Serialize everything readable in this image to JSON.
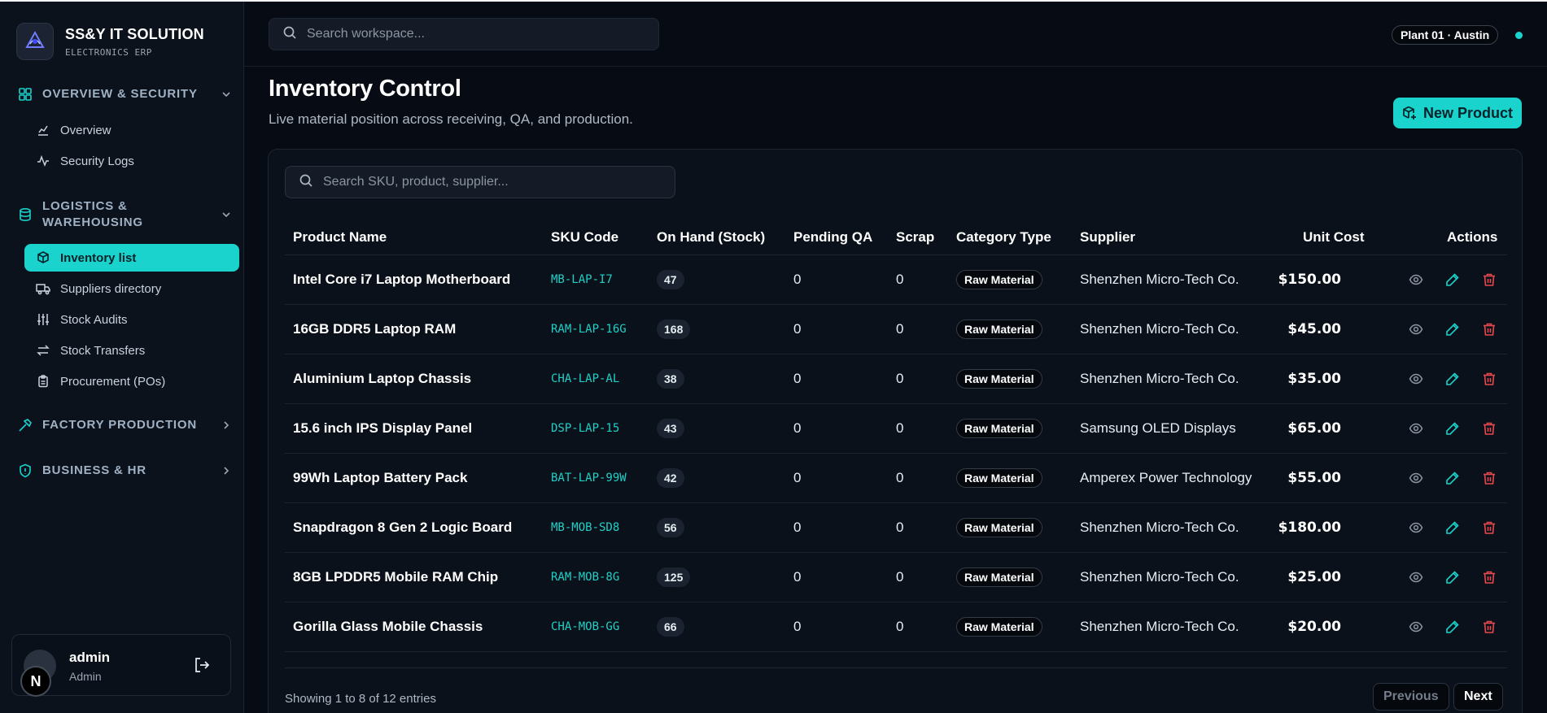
{
  "brand": {
    "name": "SS&Y IT SOLUTION",
    "subtitle": "ELECTRONICS ERP",
    "logo_icon": "ssy-logo-icon"
  },
  "sidebar": {
    "sections": [
      {
        "label": "OVERVIEW & SECURITY",
        "icon": "grid-icon",
        "expanded": true,
        "items": [
          {
            "label": "Overview",
            "icon": "chart-icon"
          },
          {
            "label": "Security Logs",
            "icon": "activity-icon"
          }
        ]
      },
      {
        "label": "LOGISTICS & WAREHOUSING",
        "icon": "database-icon",
        "expanded": true,
        "items": [
          {
            "label": "Inventory list",
            "icon": "package-icon",
            "active": true
          },
          {
            "label": "Suppliers directory",
            "icon": "truck-icon"
          },
          {
            "label": "Stock Audits",
            "icon": "sliders-icon"
          },
          {
            "label": "Stock Transfers",
            "icon": "transfer-icon"
          },
          {
            "label": "Procurement (POs)",
            "icon": "clipboard-icon"
          }
        ]
      },
      {
        "label": "FACTORY PRODUCTION",
        "icon": "hammer-icon",
        "expanded": false,
        "items": []
      },
      {
        "label": "BUSINESS & HR",
        "icon": "shield-icon",
        "expanded": false,
        "items": []
      }
    ]
  },
  "user": {
    "name": "admin",
    "role": "Admin",
    "badge": "N"
  },
  "topbar": {
    "search_placeholder": "Search workspace...",
    "plant": "Plant 01 · Austin",
    "status_color": "#19d3cc"
  },
  "page": {
    "title": "Inventory Control",
    "subtitle": "Live material position across receiving, QA, and production.",
    "new_button": "New Product"
  },
  "table": {
    "search_placeholder": "Search SKU, product, supplier...",
    "headers": [
      "Product Name",
      "SKU Code",
      "On Hand (Stock)",
      "Pending QA",
      "Scrap",
      "Category Type",
      "Supplier",
      "Unit Cost",
      "Actions"
    ],
    "rows": [
      {
        "name": "Intel Core i7 Laptop Motherboard",
        "sku": "MB-LAP-I7",
        "stock": "47",
        "pending": "0",
        "scrap": "0",
        "category": "Raw Material",
        "supplier": "Shenzhen Micro-Tech Co.",
        "cost": "$150.00"
      },
      {
        "name": "16GB DDR5 Laptop RAM",
        "sku": "RAM-LAP-16G",
        "stock": "168",
        "pending": "0",
        "scrap": "0",
        "category": "Raw Material",
        "supplier": "Shenzhen Micro-Tech Co.",
        "cost": "$45.00"
      },
      {
        "name": "Aluminium Laptop Chassis",
        "sku": "CHA-LAP-AL",
        "stock": "38",
        "pending": "0",
        "scrap": "0",
        "category": "Raw Material",
        "supplier": "Shenzhen Micro-Tech Co.",
        "cost": "$35.00"
      },
      {
        "name": "15.6 inch IPS Display Panel",
        "sku": "DSP-LAP-15",
        "stock": "43",
        "pending": "0",
        "scrap": "0",
        "category": "Raw Material",
        "supplier": "Samsung OLED Displays",
        "cost": "$65.00"
      },
      {
        "name": "99Wh Laptop Battery Pack",
        "sku": "BAT-LAP-99W",
        "stock": "42",
        "pending": "0",
        "scrap": "0",
        "category": "Raw Material",
        "supplier": "Amperex Power Technology",
        "cost": "$55.00"
      },
      {
        "name": "Snapdragon 8 Gen 2 Logic Board",
        "sku": "MB-MOB-SD8",
        "stock": "56",
        "pending": "0",
        "scrap": "0",
        "category": "Raw Material",
        "supplier": "Shenzhen Micro-Tech Co.",
        "cost": "$180.00"
      },
      {
        "name": "8GB LPDDR5 Mobile RAM Chip",
        "sku": "RAM-MOB-8G",
        "stock": "125",
        "pending": "0",
        "scrap": "0",
        "category": "Raw Material",
        "supplier": "Shenzhen Micro-Tech Co.",
        "cost": "$25.00"
      },
      {
        "name": "Gorilla Glass Mobile Chassis",
        "sku": "CHA-MOB-GG",
        "stock": "66",
        "pending": "0",
        "scrap": "0",
        "category": "Raw Material",
        "supplier": "Shenzhen Micro-Tech Co.",
        "cost": "$20.00"
      }
    ],
    "footer": "Showing 1 to 8 of 12 entries",
    "prev_label": "Previous",
    "next_label": "Next"
  },
  "colors": {
    "accent": "#19d3cc",
    "danger": "#e5484d",
    "background": "#070c14"
  }
}
